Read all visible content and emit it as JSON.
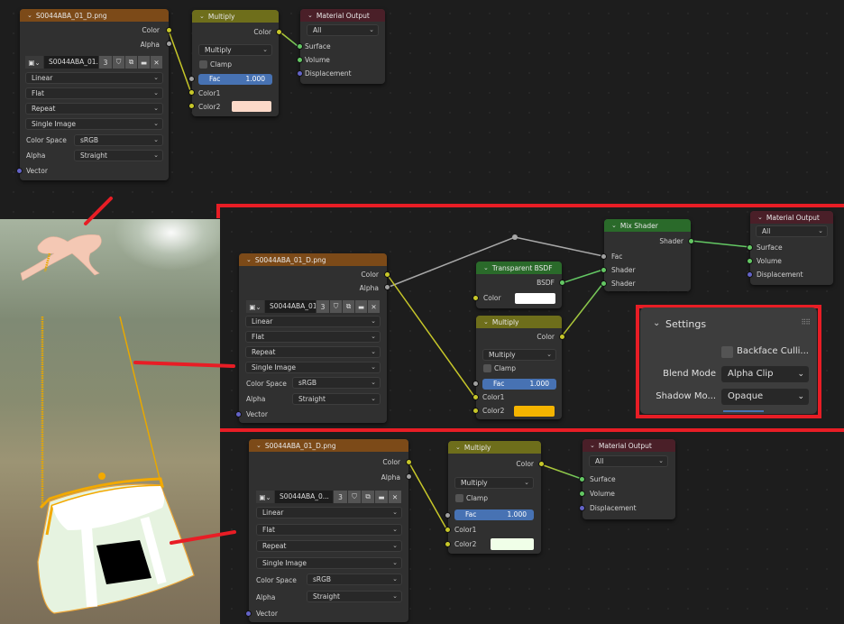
{
  "image_node_label": {
    "title": "S0044ABA_01_D.png",
    "out_color": "Color",
    "out_alpha": "Alpha",
    "image_name_top": "S0044ABA_01...",
    "image_name_mid": "S0044ABA_01...",
    "image_name_bottom": "S0044ABA_0...",
    "users": "3",
    "interpolation": "Linear",
    "projection": "Flat",
    "extension": "Repeat",
    "source": "Single Image",
    "color_space_label": "Color Space",
    "color_space": "sRGB",
    "alpha_label": "Alpha",
    "alpha_mode": "Straight",
    "vector": "Vector"
  },
  "mix_node": {
    "title": "Multiply",
    "out_color": "Color",
    "blend": "Multiply",
    "clamp": "Clamp",
    "fac_label": "Fac",
    "fac_value": "1.000",
    "color1": "Color1",
    "color2": "Color2",
    "color2_top": "#fcd9c8",
    "color2_mid": "#f5b400",
    "color2_bottom": "#f0ffe8"
  },
  "output_node": {
    "title": "Material Output",
    "target": "All",
    "surface": "Surface",
    "volume": "Volume",
    "displacement": "Displacement"
  },
  "transparent_node": {
    "title": "Transparent BSDF",
    "out": "BSDF",
    "color": "Color",
    "color_value": "#ffffff"
  },
  "mix_shader_node": {
    "title": "Mix Shader",
    "out": "Shader",
    "fac": "Fac",
    "shader1": "Shader",
    "shader2": "Shader"
  },
  "settings_panel": {
    "title": "Settings",
    "backface": "Backface Culli...",
    "blend_mode_label": "Blend Mode",
    "blend_mode": "Alpha Clip",
    "shadow_mode_label": "Shadow Mo...",
    "shadow_mode": "Opaque"
  },
  "annotation_color": "#e81d25"
}
